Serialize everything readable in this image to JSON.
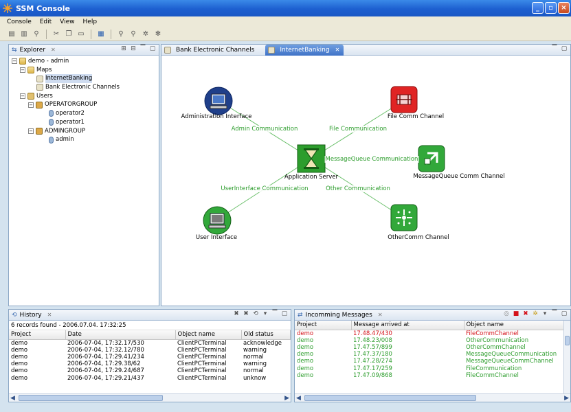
{
  "window": {
    "title": "SSM Console"
  },
  "menu": [
    "Console",
    "Edit",
    "View",
    "Help"
  ],
  "explorer": {
    "tab": "Explorer",
    "tree": [
      {
        "label": "demo - admin",
        "level": 0,
        "icon": "folder-icon",
        "expand": "-"
      },
      {
        "label": "Maps",
        "level": 1,
        "icon": "map-folder-icon",
        "expand": "-"
      },
      {
        "label": "InternetBanking",
        "level": 2,
        "icon": "map-icon",
        "selected": true
      },
      {
        "label": "Bank Electronic Channels",
        "level": 2,
        "icon": "map-icon"
      },
      {
        "label": "Users",
        "level": 1,
        "icon": "users-icon",
        "expand": "-"
      },
      {
        "label": "OPERATORGROUP",
        "level": 2,
        "icon": "group-icon",
        "expand": "-"
      },
      {
        "label": "operator2",
        "level": 3,
        "icon": "user-icon"
      },
      {
        "label": "operator1",
        "level": 3,
        "icon": "user-icon"
      },
      {
        "label": "ADMINGROUP",
        "level": 2,
        "icon": "group-icon",
        "expand": "-"
      },
      {
        "label": "admin",
        "level": 3,
        "icon": "user-icon"
      }
    ]
  },
  "editor": {
    "tabs": [
      {
        "label": "Bank Electronic Channels"
      },
      {
        "label": "InternetBanking",
        "active": true
      }
    ],
    "nodes": {
      "admin": "Administration Interface",
      "file": "File Comm Channel",
      "mq": "MessageQueue Comm Channel",
      "app": "Application Server",
      "ui": "User Interface",
      "other": "OtherComm Channel"
    },
    "edges": {
      "admin": "Admin Communication",
      "file": "File Communication",
      "mq": "MessageQueue Communication",
      "ui": "UserInterface Communication",
      "other": "Other Communication"
    }
  },
  "history": {
    "tab": "History",
    "summary": "6 records found - 2006.07.04. 17:32:25",
    "columns": [
      "Project",
      "Date",
      "Object name",
      "Old status"
    ],
    "rows": [
      [
        "demo",
        "2006-07-04, 17:32.17/530",
        "ClientPCTerminal",
        "acknowledge"
      ],
      [
        "demo",
        "2006-07-04, 17:32.12/780",
        "ClientPCTerminal",
        "warning"
      ],
      [
        "demo",
        "2006-07-04, 17:29.41/234",
        "ClientPCTerminal",
        "normal"
      ],
      [
        "demo",
        "2006-07-04, 17:29.38/62",
        "ClientPCTerminal",
        "warning"
      ],
      [
        "demo",
        "2006-07-04, 17:29.24/687",
        "ClientPCTerminal",
        "normal"
      ],
      [
        "demo",
        "2006-07-04, 17:29.21/437",
        "ClientPCTerminal",
        "unknow"
      ]
    ]
  },
  "messages": {
    "tab": "Incomming Messages",
    "columns": [
      "Project",
      "Message arrived at",
      "Object name"
    ],
    "rows": [
      [
        "demo",
        "17.48.47/430",
        "FileCommChannel",
        "red"
      ],
      [
        "demo",
        "17.48.23/008",
        "OtherCommunication",
        "green"
      ],
      [
        "demo",
        "17.47.57/899",
        "OtherCommChannel",
        "green"
      ],
      [
        "demo",
        "17.47.37/180",
        "MessageQueueCommunication",
        "green"
      ],
      [
        "demo",
        "17.47.28/274",
        "MessageQueueCommChannel",
        "green"
      ],
      [
        "demo",
        "17.47.17/259",
        "FileCommunication",
        "green"
      ],
      [
        "demo",
        "17.47.09/868",
        "FileCommChannel",
        "green"
      ]
    ]
  },
  "colors": {
    "edge": "#2d9d2d",
    "accent": "#3f73c7",
    "alert": "#d4121a"
  }
}
